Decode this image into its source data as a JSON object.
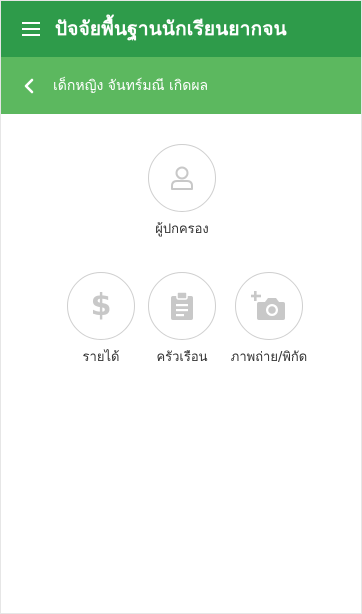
{
  "header": {
    "title": "ปัจจัยพื้นฐานนักเรียนยากจน",
    "menu_icon": "hamburger-menu-icon"
  },
  "subheader": {
    "title": "เด็กหญิง จันทร์มณี เกิดผล",
    "back_icon": "chevron-left-icon"
  },
  "menu": {
    "guardian": {
      "label": "ผู้ปกครอง",
      "icon": "person-icon"
    },
    "income": {
      "label": "รายได้",
      "icon": "dollar-icon"
    },
    "household": {
      "label": "ครัวเรือน",
      "icon": "clipboard-icon"
    },
    "photo": {
      "label": "ภาพถ่าย/พิกัด",
      "icon": "add-photo-icon"
    }
  },
  "colors": {
    "appbar": "#2e9b4a",
    "subbar": "#5cb85f",
    "icon": "#c8c8c8",
    "circle_border": "#cfcfcf",
    "label": "#333333"
  }
}
